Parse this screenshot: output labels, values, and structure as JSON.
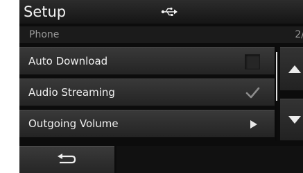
{
  "header": {
    "title": "Setup",
    "usb_icon": "usb-icon"
  },
  "subheader": {
    "label": "Phone",
    "page": "2/"
  },
  "menu": {
    "items": [
      {
        "label": "Auto Download",
        "control": "checkbox",
        "checked": false
      },
      {
        "label": "Audio Streaming",
        "control": "checkbox",
        "checked": true,
        "icon": "checkmark-icon"
      },
      {
        "label": "Outgoing Volume",
        "control": "submenu",
        "icon": "arrow-right-icon"
      }
    ]
  },
  "scroll": {
    "up_icon": "triangle-up-icon",
    "down_icon": "triangle-down-icon"
  },
  "footer": {
    "back_icon": "return-arrow-icon"
  },
  "colors": {
    "background": "#0c0c0c",
    "item": "#2e2e2e",
    "text": "#f0f0f0",
    "muted_text": "#9a9a9a"
  }
}
